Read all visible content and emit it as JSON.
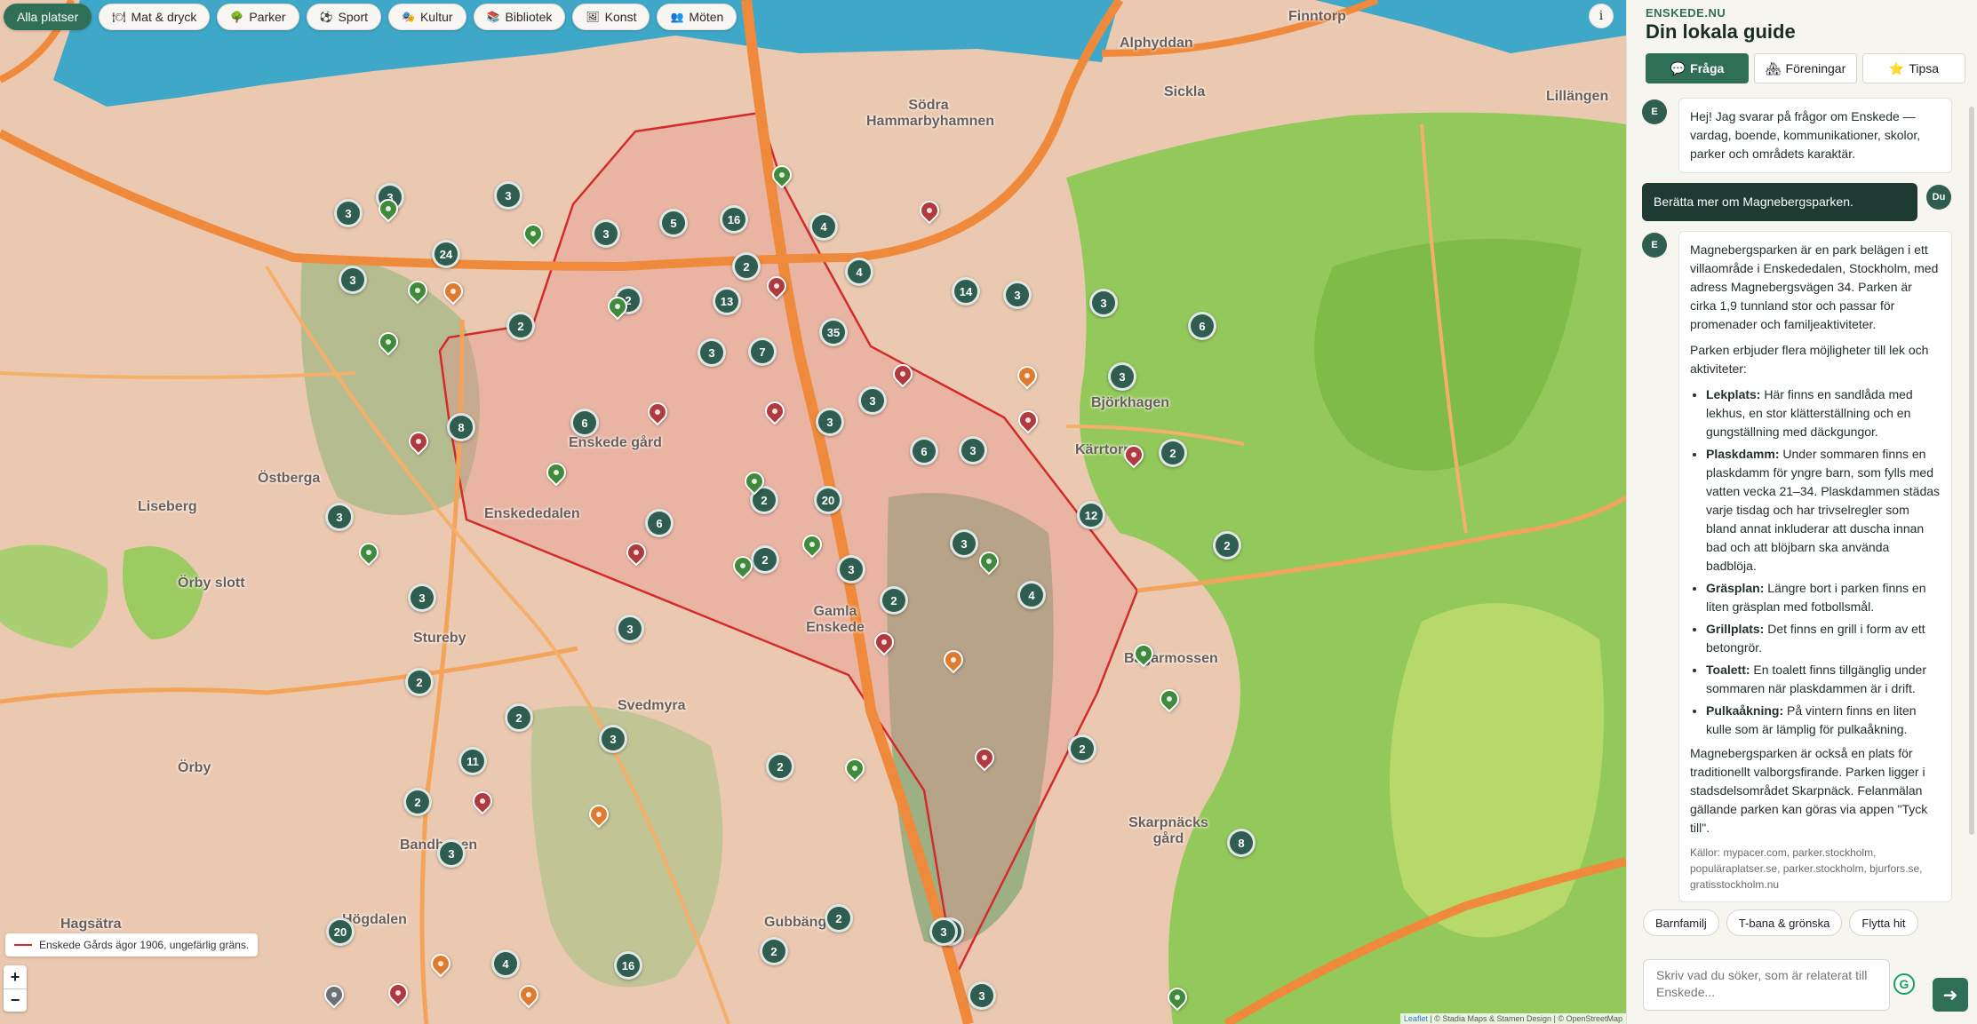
{
  "filters": [
    {
      "label": "Alla platser",
      "icon": "",
      "active": true
    },
    {
      "label": "Mat & dryck",
      "icon": "🍽",
      "active": false
    },
    {
      "label": "Parker",
      "icon": "🌳",
      "active": false
    },
    {
      "label": "Sport",
      "icon": "⚽",
      "active": false
    },
    {
      "label": "Kultur",
      "icon": "🎭",
      "active": false
    },
    {
      "label": "Bibliotek",
      "icon": "📚",
      "active": false
    },
    {
      "label": "Konst",
      "icon": "🖼",
      "active": false
    },
    {
      "label": "Möten",
      "icon": "👥",
      "active": false
    }
  ],
  "map": {
    "info_label": "i",
    "legend": "Enskede Gårds ägor 1906, ungefärlig gräns.",
    "zoom_in": "+",
    "zoom_out": "−",
    "attribution": {
      "leaflet": "Leaflet",
      "rest": " | © Stadia Maps & Stamen Design | © OpenStreetMap"
    },
    "boundary_color": "#d32b2b",
    "place_labels": [
      "Alphyddan",
      "Finntorp",
      "Sickla",
      "Lillängen",
      "Södra Hammarbyhamnen",
      "Östberga",
      "Liseberg",
      "Enskededalen",
      "Örby slott",
      "Stureby",
      "Svedmyra",
      "Örby",
      "Bandhagen",
      "Högdalen",
      "Hagsätra",
      "Gubbängen",
      "Gamla Enskede",
      "Skarpnäcks gård",
      "Bagarmossen",
      "Björkhagen",
      "Kärrtorp",
      "Enskede gård"
    ],
    "clusters": [
      "3",
      "3",
      "3",
      "3",
      "24",
      "3",
      "5",
      "16",
      "4",
      "2",
      "4",
      "2",
      "13",
      "14",
      "3",
      "3",
      "2",
      "6",
      "3",
      "7",
      "35",
      "3",
      "8",
      "6",
      "3",
      "3",
      "3",
      "6",
      "2",
      "12",
      "3",
      "2",
      "20",
      "6",
      "3",
      "2",
      "3",
      "2",
      "4",
      "3",
      "3",
      "2",
      "2",
      "2",
      "3",
      "11",
      "2",
      "2",
      "3",
      "20",
      "4",
      "2",
      "16",
      "2",
      "3",
      "2",
      "8",
      "3",
      "2"
    ]
  },
  "sidebar": {
    "brand": "ENSKEDE.NU",
    "title": "Din lokala guide",
    "tabs": [
      {
        "label": "Fråga",
        "icon": "💬",
        "active": true
      },
      {
        "label": "Föreningar",
        "icon": "🏘",
        "active": false
      },
      {
        "label": "Tipsa",
        "icon": "⭐",
        "active": false
      }
    ],
    "assistant_avatar": "E",
    "user_avatar": "Du",
    "messages": {
      "greeting": "Hej! Jag svarar på frågor om Enskede — vardag, boende, kommunikationer, skolor, parker och områdets karaktär.",
      "user": "Berätta mer om Magnebergsparken.",
      "answer_p1": "Magnebergsparken är en park belägen i ett villaområde i Enskededalen, Stockholm, med adress Magnebergsvägen 34. Parken är cirka 1,9 tunnland stor och passar för promenader och familjeaktiviteter.",
      "answer_p2": "Parken erbjuder flera möjligheter till lek och aktiviteter:",
      "items": [
        {
          "term": "Lekplats:",
          "text": " Här finns en sandlåda med lekhus, en stor klätterställning och en gungställning med däckgungor."
        },
        {
          "term": "Plaskdamm:",
          "text": " Under sommaren finns en plaskdamm för yngre barn, som fylls med vatten vecka 21–34. Plaskdammen städas varje tisdag och har trivselregler som bland annat inkluderar att duscha innan bad och att blöjbarn ska använda badblöja."
        },
        {
          "term": "Gräsplan:",
          "text": " Längre bort i parken finns en liten gräsplan med fotbollsmål."
        },
        {
          "term": "Grillplats:",
          "text": " Det finns en grill i form av ett betongrör."
        },
        {
          "term": "Toalett:",
          "text": " En toalett finns tillgänglig under sommaren när plaskdammen är i drift."
        },
        {
          "term": "Pulkaåkning:",
          "text": " På vintern finns en liten kulle som är lämplig för pulkaåkning."
        }
      ],
      "answer_p3": "Magnebergsparken är också en plats för traditionellt valborgsfirande. Parken ligger i stadsdelsområdet Skarpnäck. Felanmälan gällande parken kan göras via appen \"Tyck till\".",
      "sources": "Källor: mypacer.com, parker.stockholm, populäraplatser.se, parker.stockholm, bjurfors.se, gratisstockholm.nu"
    },
    "suggestions": [
      "Barnfamilj",
      "T-bana & grönska",
      "Flytta hit"
    ],
    "composer_placeholder": "Skriv vad du söker, som är relaterat till Enskede...",
    "grammarly_icon": "G",
    "send_label": "➜"
  }
}
